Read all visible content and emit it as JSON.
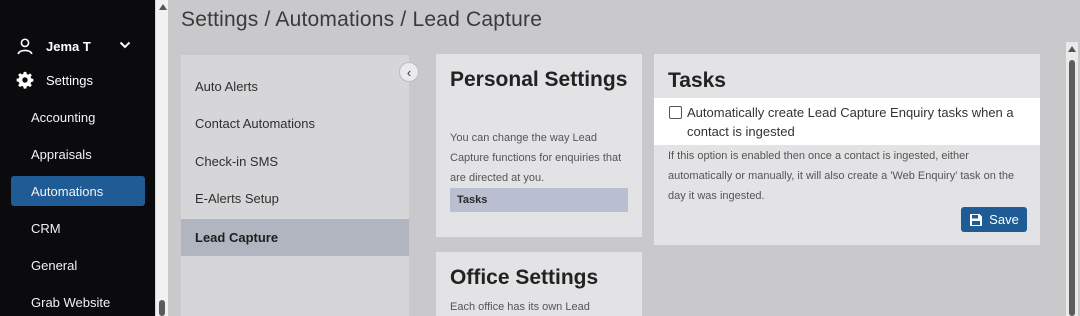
{
  "user": {
    "name": "Jema T"
  },
  "sidebar": {
    "settings_label": "Settings",
    "items": [
      {
        "label": "Accounting"
      },
      {
        "label": "Appraisals"
      },
      {
        "label": "Automations"
      },
      {
        "label": "CRM"
      },
      {
        "label": "General"
      },
      {
        "label": "Grab Website"
      }
    ]
  },
  "header": {
    "title": "Settings / Automations / Lead Capture"
  },
  "subnav": {
    "items": [
      {
        "label": "Auto Alerts"
      },
      {
        "label": "Contact Automations"
      },
      {
        "label": "Check-in SMS"
      },
      {
        "label": "E-Alerts Setup"
      },
      {
        "label": "Lead Capture"
      }
    ],
    "collapse_glyph": "‹"
  },
  "personal": {
    "title": "Personal Settings",
    "description": "You can change the way Lead Capture functions for enquiries that are directed at you.",
    "tag": "Tasks"
  },
  "office": {
    "title": "Office Settings",
    "description": "Each office has its own Lead"
  },
  "tasks": {
    "title": "Tasks",
    "checkbox_label": "Automatically create Lead Capture Enquiry tasks when a contact is ingested",
    "checked": false,
    "description": "If this option is enabled then once a contact is ingested, either automatically or manually, it will also create a 'Web Enquiry' task on the day it was ingested.",
    "save_label": "Save"
  },
  "colors": {
    "sidebar_bg": "#0b0b0e",
    "accent": "#1f5b94",
    "active_subnav": "#b1b5bf"
  }
}
